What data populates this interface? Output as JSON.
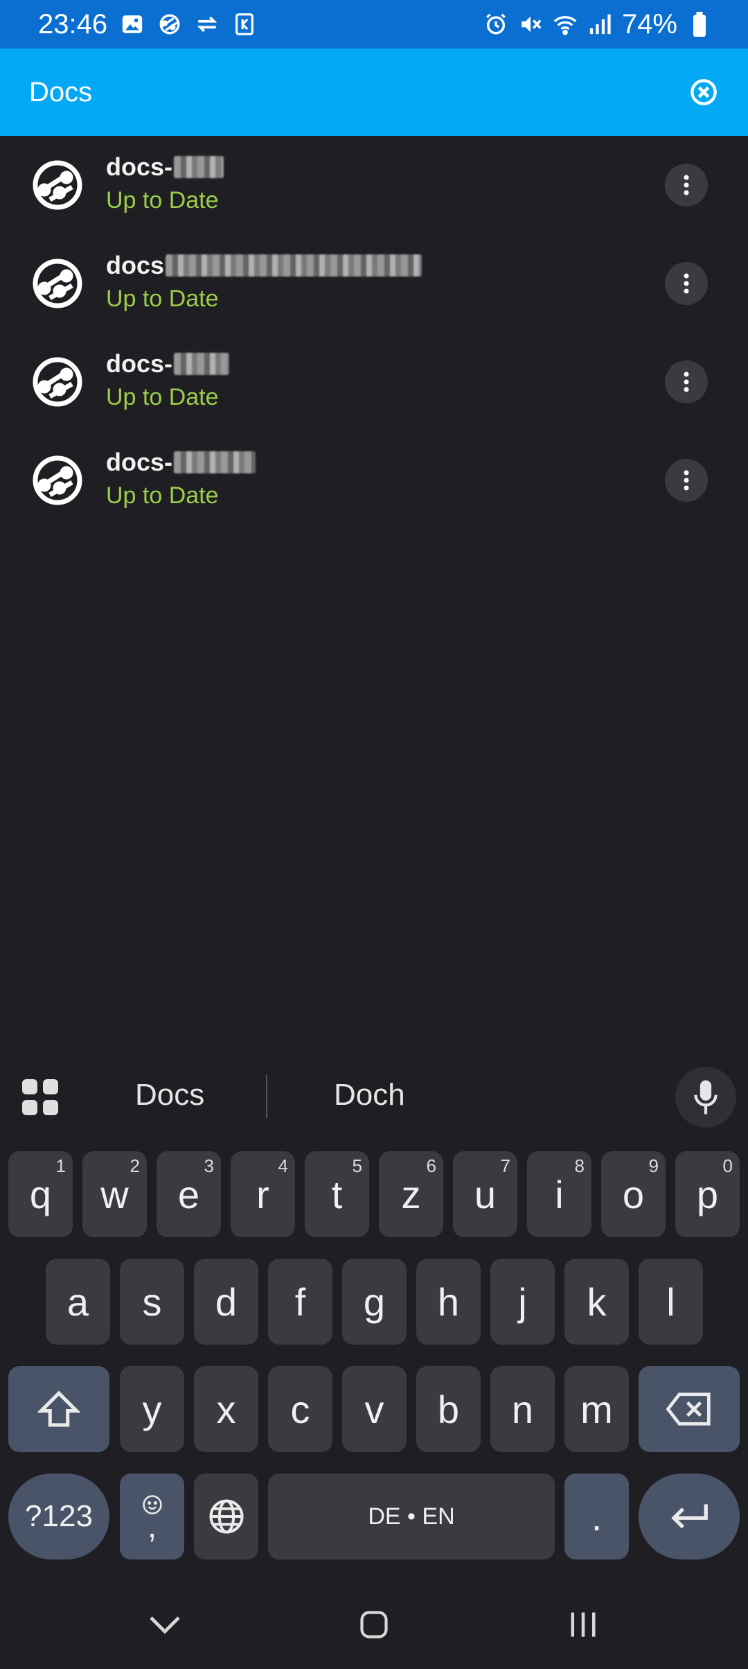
{
  "status_bar": {
    "time": "23:46",
    "battery": "74%",
    "left_icons": [
      "gallery-icon",
      "sync-icon",
      "transfer-icon",
      "sim-icon"
    ],
    "right_icons": [
      "alarm-icon",
      "mute-icon",
      "wifi-icon",
      "signal-icon",
      "battery-icon"
    ]
  },
  "search": {
    "value": "Docs",
    "clear_icon": "close-circle-icon"
  },
  "repos": [
    {
      "name": "docs-",
      "status": "Up to Date"
    },
    {
      "name": "docs",
      "status": "Up to Date"
    },
    {
      "name": "docs-",
      "status": "Up to Date"
    },
    {
      "name": "docs-",
      "status": "Up to Date"
    }
  ],
  "keyboard": {
    "suggestions": [
      "Docs",
      "Doch"
    ],
    "row1": [
      "q",
      "w",
      "e",
      "r",
      "t",
      "z",
      "u",
      "i",
      "o",
      "p"
    ],
    "row1_hints": [
      "1",
      "2",
      "3",
      "4",
      "5",
      "6",
      "7",
      "8",
      "9",
      "0"
    ],
    "row2": [
      "a",
      "s",
      "d",
      "f",
      "g",
      "h",
      "j",
      "k",
      "l"
    ],
    "row3": [
      "y",
      "x",
      "c",
      "v",
      "b",
      "n",
      "m"
    ],
    "symbols_key": "?123",
    "comma_key": ",",
    "space_label": "DE • EN",
    "period_key": "."
  },
  "colors": {
    "status_bar": "#0a6fd0",
    "app_bar": "#03a9f4",
    "background": "#1e1e23",
    "status_text": "#9ccc4a"
  }
}
